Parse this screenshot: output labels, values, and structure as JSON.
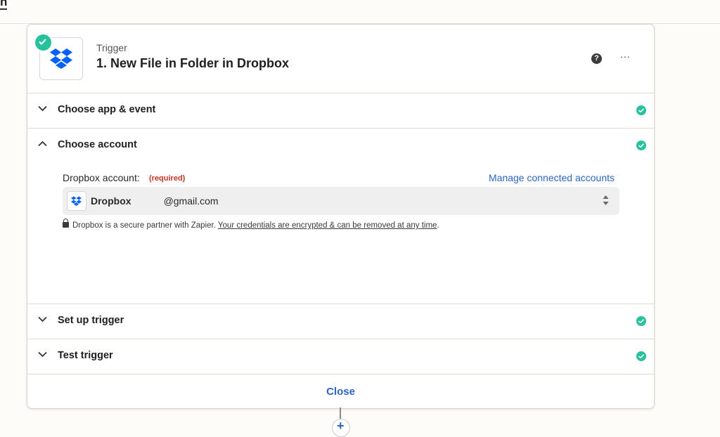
{
  "step": {
    "kicker": "Trigger",
    "title": "1. New File in Folder in Dropbox",
    "help_icon": "?",
    "more_icon": "···"
  },
  "sections": [
    {
      "label": "Choose app & event",
      "state": "collapsed",
      "complete": true
    },
    {
      "label": "Choose account",
      "state": "expanded",
      "complete": true
    },
    {
      "label": "Set up trigger",
      "state": "collapsed",
      "complete": true
    },
    {
      "label": "Test trigger",
      "state": "collapsed",
      "complete": true
    }
  ],
  "account": {
    "field_label": "Dropbox account:",
    "required_label": "(required)",
    "manage_link": "Manage connected accounts",
    "selected_prefix": "Dropbox",
    "selected_suffix": "@gmail.com",
    "note_plain": "Dropbox is a secure partner with Zapier.",
    "note_link": "Your credentials are encrypted & can be removed at any time",
    "note_end": "."
  },
  "footer": {
    "close_label": "Close"
  },
  "colors": {
    "accent": "#2a66c4",
    "success": "#26c29d",
    "required": "#c8331d"
  }
}
